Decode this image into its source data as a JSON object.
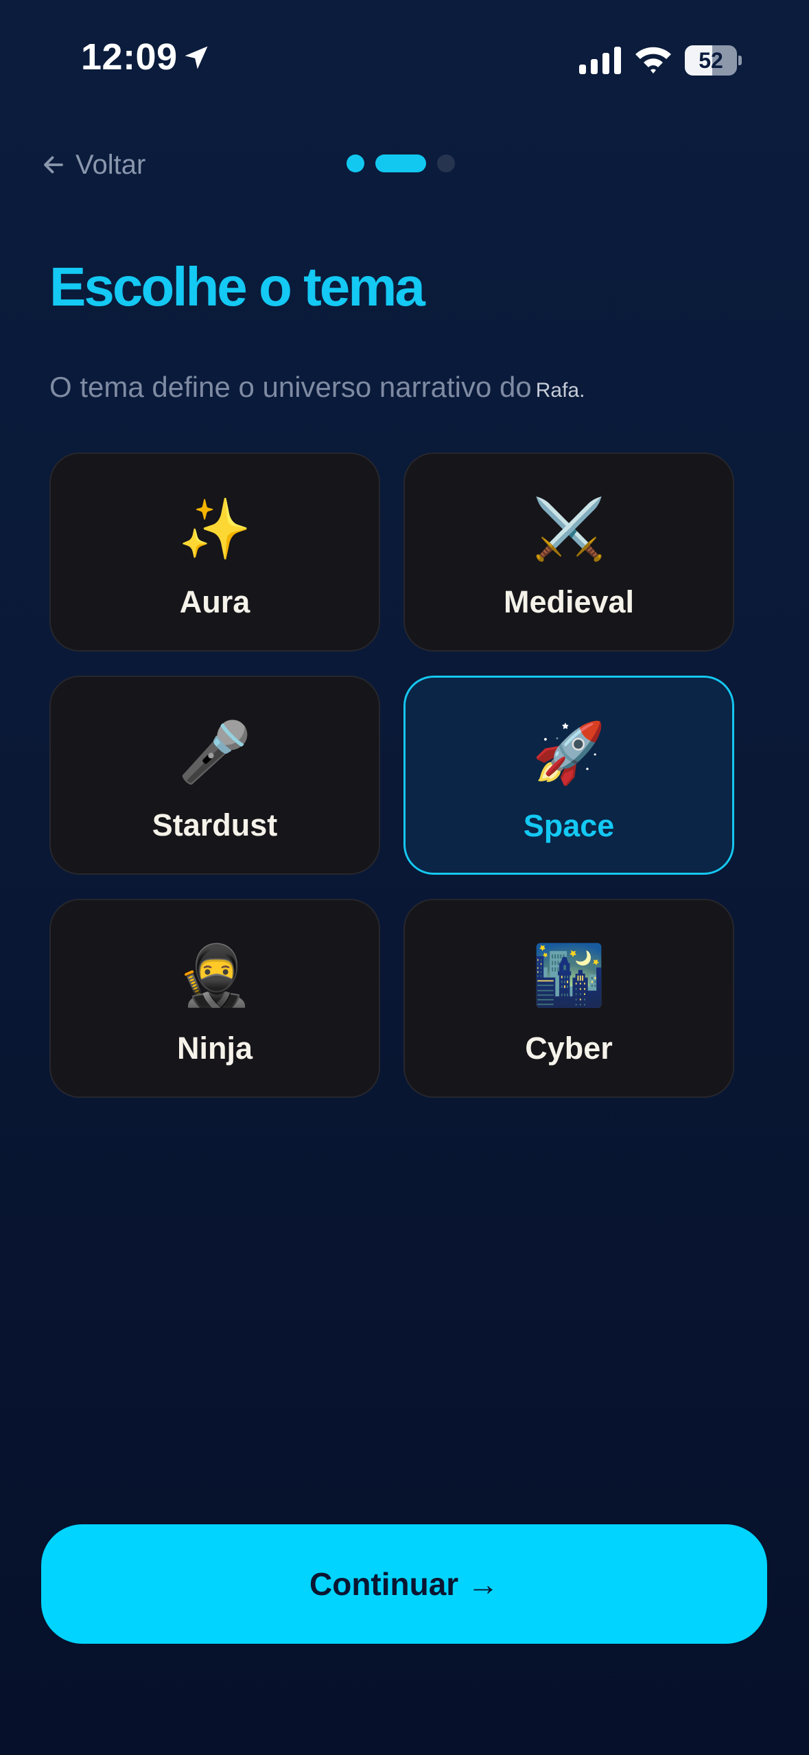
{
  "status_bar": {
    "time": "12:09",
    "battery_level": 52,
    "battery_text": "52"
  },
  "nav": {
    "back_label": "Voltar",
    "progress": {
      "total_steps": 3,
      "current_step": 2
    }
  },
  "header": {
    "title": "Escolhe o tema",
    "subtitle": "O tema define o universo narrativo do",
    "name": "Rafa."
  },
  "themes": [
    {
      "emoji": "✨",
      "label": "Aura",
      "icon": "sparkles-icon",
      "selected": false
    },
    {
      "emoji": "⚔️",
      "label": "Medieval",
      "icon": "crossed-swords-icon",
      "selected": false
    },
    {
      "emoji": "🎤",
      "label": "Stardust",
      "icon": "microphone-icon",
      "selected": false
    },
    {
      "emoji": "🚀",
      "label": "Space",
      "icon": "rocket-icon",
      "selected": true
    },
    {
      "emoji": "🥷",
      "label": "Ninja",
      "icon": "ninja-icon",
      "selected": false
    },
    {
      "emoji": "🌃",
      "label": "Cyber",
      "icon": "night-city-icon",
      "selected": false
    }
  ],
  "footer": {
    "continue_label": "Continuar →"
  },
  "colors": {
    "accent": "#14c9f3",
    "button": "#00d4ff",
    "background": "#0a1937",
    "card": "#161519",
    "selected_card": "#0a2546"
  }
}
